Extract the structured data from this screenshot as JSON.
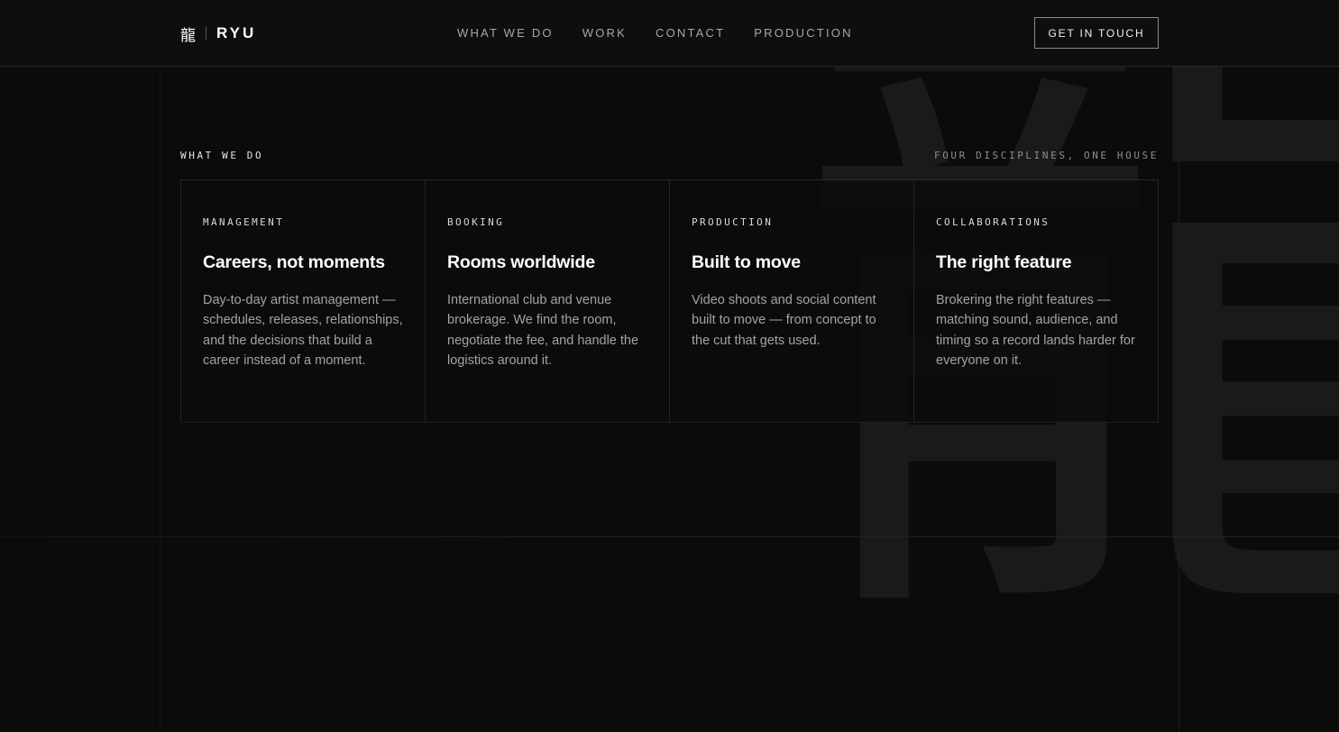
{
  "header": {
    "logo_glyph": "龍",
    "logo_word": "RYU",
    "nav": [
      "WHAT WE DO",
      "WORK",
      "CONTACT",
      "PRODUCTION"
    ],
    "cta_label": "GET IN TOUCH"
  },
  "background": {
    "glyph": "龍"
  },
  "section": {
    "eyebrow": "WHAT WE DO",
    "tagline": "FOUR DISCIPLINES, ONE HOUSE",
    "cards": [
      {
        "tag": "MANAGEMENT",
        "title": "Careers, not moments",
        "body": "Day-to-day artist management — schedules, releases, relationships, and the decisions that build a career instead of a moment."
      },
      {
        "tag": "BOOKING",
        "title": "Rooms worldwide",
        "body": "International club and venue brokerage. We find the room, negotiate the fee, and handle the logistics around it."
      },
      {
        "tag": "PRODUCTION",
        "title": "Built to move",
        "body": "Video shoots and social content built to move — from concept to the cut that gets used."
      },
      {
        "tag": "COLLABORATIONS",
        "title": "The right feature",
        "body": "Brokering the right features — matching sound, audience, and timing so a record lands harder for everyone on it."
      }
    ]
  },
  "colors": {
    "background": "#0b0b0b",
    "text_primary": "#ffffff",
    "text_muted": "#a3a3a3",
    "border": "#232323"
  }
}
